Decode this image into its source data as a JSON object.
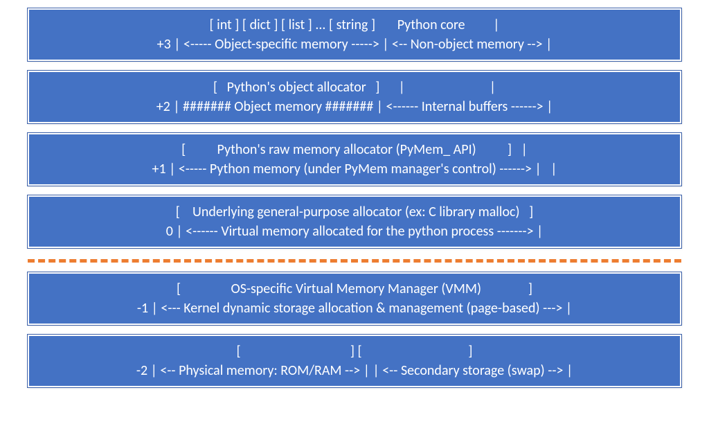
{
  "layers": {
    "layer_plus3": {
      "line1": "[ int ] [ dict ] [ list ] ... [ string ]       Python core         |",
      "line2": "+3 | <----- Object-specific memory -----> | <-- Non-object memory --> |"
    },
    "layer_plus2": {
      "line1": "[   Python's object allocator   ]      |                           |",
      "line2": "+2 | ####### Object memory ####### | <------ Internal buffers ------> |"
    },
    "layer_plus1": {
      "line1": "[          Python's raw memory allocator (PyMem_ API)          ]   |",
      "line2": "+1 | <----- Python memory (under PyMem manager's control) ------> |   |"
    },
    "layer_0": {
      "line1": "[    Underlying general-purpose allocator (ex: C library malloc)   ]",
      "line2": "0 | <------ Virtual memory allocated for the python process -------> |"
    },
    "layer_minus1": {
      "line1": "[                OS-specific Virtual Memory Manager (VMM)               ]",
      "line2": "-1 | <--- Kernel dynamic storage allocation & management (page-based) ---> |"
    },
    "layer_minus2": {
      "line1": "[                                   ] [                                  ]",
      "line2": "-2 | <-- Physical memory: ROM/RAM --> | | <-- Secondary storage (swap) --> |"
    }
  }
}
